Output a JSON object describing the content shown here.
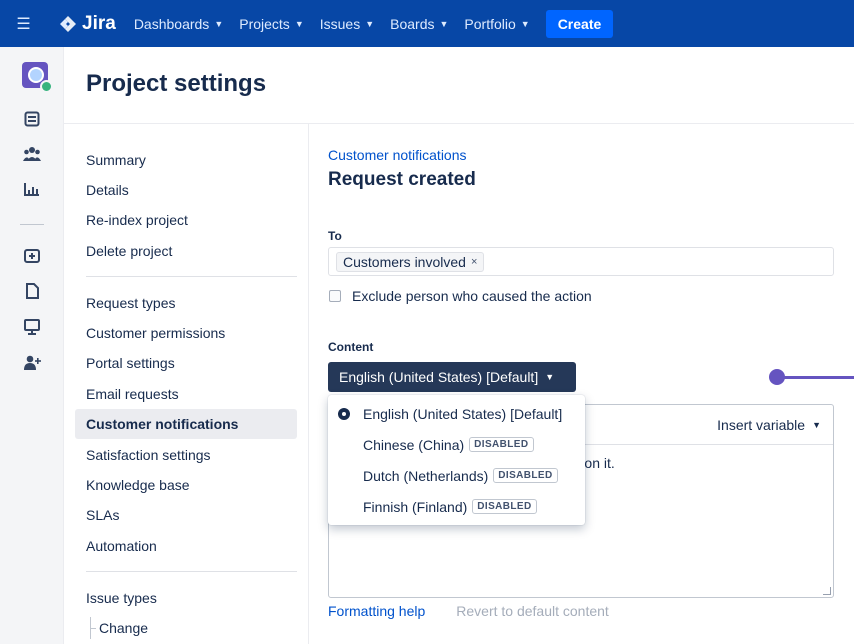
{
  "topbar": {
    "hamburger_icon": "menu-icon",
    "product": "Jira",
    "nav": [
      {
        "label": "Dashboards"
      },
      {
        "label": "Projects"
      },
      {
        "label": "Issues"
      },
      {
        "label": "Boards"
      },
      {
        "label": "Portfolio"
      }
    ],
    "create_label": "Create",
    "bg_color": "#0747A6"
  },
  "rail": {
    "icons": [
      "project-avatar-icon",
      "board-icon",
      "people-icon",
      "reports-icon",
      "add-item-icon",
      "page-icon",
      "monitor-icon",
      "add-user-icon"
    ]
  },
  "page": {
    "title": "Project settings"
  },
  "sidebar": {
    "group1": [
      "Summary",
      "Details",
      "Re-index project",
      "Delete project"
    ],
    "group2": [
      "Request types",
      "Customer permissions",
      "Portal settings",
      "Email requests",
      "Customer notifications",
      "Satisfaction settings",
      "Knowledge base",
      "SLAs",
      "Automation"
    ],
    "group3": [
      "Issue types"
    ],
    "sub": [
      "Change"
    ],
    "active": "Customer notifications"
  },
  "main": {
    "breadcrumb": "Customer notifications",
    "title": "Request created",
    "to_label": "To",
    "to_chip": "Customers involved",
    "to_chip_remove": "×",
    "exclude_label": "Exclude person who caused the action",
    "content_label": "Content",
    "language_button": "English (United States) [Default]",
    "insert_variable": "Insert variable",
    "editor_text": "st. We're on it.",
    "formatting_help": "Formatting help",
    "revert": "Revert to default content"
  },
  "language_menu": {
    "items": [
      {
        "label": "English (United States) [Default]",
        "selected": true,
        "badge": ""
      },
      {
        "label": "Chinese (China)",
        "selected": false,
        "badge": "DISABLED"
      },
      {
        "label": "Dutch (Netherlands)",
        "selected": false,
        "badge": "DISABLED"
      },
      {
        "label": "Finnish (Finland)",
        "selected": false,
        "badge": "DISABLED"
      }
    ]
  },
  "colors": {
    "accent": "#0052CC",
    "slider": "#6554C0",
    "dark_button": "#253858"
  }
}
